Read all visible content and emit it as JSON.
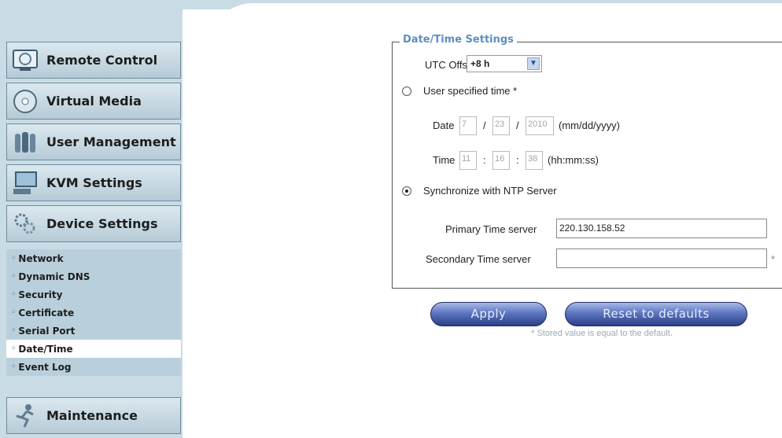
{
  "sidebar": {
    "menu": [
      {
        "label": "Remote Control",
        "icon": "monitor-icon"
      },
      {
        "label": "Virtual Media",
        "icon": "disc-icon"
      },
      {
        "label": "User Management",
        "icon": "users-icon"
      },
      {
        "label": "KVM Settings",
        "icon": "keyboard-monitor-icon"
      },
      {
        "label": "Device Settings",
        "icon": "gears-icon"
      }
    ],
    "sub_items": [
      "Network",
      "Dynamic DNS",
      "Security",
      "Certificate",
      "Serial Port",
      "Date/Time",
      "Event Log"
    ],
    "active_sub_item": "Date/Time",
    "maintenance": {
      "label": "Maintenance",
      "icon": "runner-icon"
    }
  },
  "datetime": {
    "legend": "Date/Time Settings",
    "utc_offset_label": "UTC Offset",
    "utc_offset_value": "+8 h",
    "user_time_label": "User specified time *",
    "date_label": "Date",
    "date_month": "7",
    "date_day": "23",
    "date_year": "2010",
    "date_sep": "/",
    "date_format": "(mm/dd/yyyy)",
    "time_label": "Time",
    "time_hour": "11",
    "time_min": "16",
    "time_sec": "38",
    "time_sep": ":",
    "time_format": "(hh:mm:ss)",
    "ntp_label": "Synchronize with NTP Server",
    "primary_label": "Primary Time server",
    "primary_value": "220.130.158.52",
    "secondary_label": "Secondary Time server",
    "secondary_value": "",
    "asterisk": "*"
  },
  "actions": {
    "apply": "Apply",
    "reset": "Reset to defaults",
    "note": "* Stored value is equal to the default."
  },
  "colors": {
    "sidebar_bg": "#c9dce6",
    "legend": "#5f8fc0",
    "button": "#3a519c"
  }
}
